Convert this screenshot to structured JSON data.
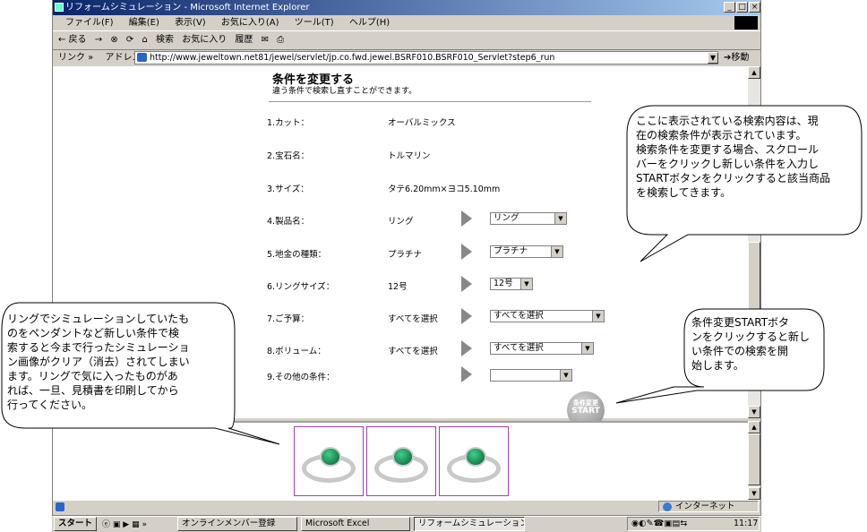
{
  "window": {
    "title": "リフォームシミュレーション - Microsoft Internet Explorer",
    "controls": {
      "minimize": "_",
      "maximize": "□",
      "close": "×"
    }
  },
  "menu": [
    "ファイル(F)",
    "編集(E)",
    "表示(V)",
    "お気に入り(A)",
    "ツール(T)",
    "ヘルプ(H)"
  ],
  "toolbar": {
    "back": "← 戻る",
    "forward": "→",
    "search": "検索",
    "favorites": "お気に入り",
    "history": "履歴"
  },
  "address": {
    "links": "リンク »",
    "label": "アドレス(D)",
    "url": "http://www.jeweltown.net81/jewel/servlet/jp.co.fwd.jewel.BSRF010.BSRF010_Servlet?step6_run",
    "go": "移動"
  },
  "page": {
    "heading": "条件を変更する",
    "subheading": "違う条件で検索し直すことができます。",
    "conditions": [
      {
        "label": "1.カット：",
        "value": "オーバルミックス"
      },
      {
        "label": "2.宝石名：",
        "value": "トルマリン"
      },
      {
        "label": "3.サイズ：",
        "value": "タテ6.20mm×ヨコ5.10mm"
      },
      {
        "label": "4.製品名：",
        "value": "リング",
        "select": "リング"
      },
      {
        "label": "5.地金の種類：",
        "value": "プラチナ",
        "select": "プラチナ"
      },
      {
        "label": "6.リングサイズ：",
        "value": "12号",
        "select": "12号"
      },
      {
        "label": "7.ご予算：",
        "value": "すべてを選択",
        "select": "すべてを選択"
      },
      {
        "label": "8.ボリューム：",
        "value": "すべてを選択",
        "select": "すべてを選択"
      },
      {
        "label": "9.その他の条件：",
        "value": "",
        "select": ""
      }
    ],
    "start_button": {
      "line1": "条件変更",
      "line2": "START"
    }
  },
  "callouts": {
    "top_right": [
      "ここに表示されている検索内容は、現",
      "在の検索条件が表示されています。",
      "検索条件を変更する場合、スクロール",
      "バーをクリックし新しい条件を入力し",
      "STARTボタンをクリックすると該当商品",
      "を検索してきます。"
    ],
    "left": [
      "リングでシミュレーションしていたも",
      "のをペンダントなど新しい条件で検",
      "索すると今まで行ったシミュレーショ",
      "ン画像がクリア（消去）されてしまい",
      "ます。リングで気に入ったものがあ",
      "れば、一旦、見積書を印刷してから",
      "行ってください。"
    ],
    "bottom_right": [
      "条件変更STARTボタ",
      "ンをクリックすると新し",
      "い条件での検索を開",
      "始します。"
    ]
  },
  "status": {
    "zone": "インターネット"
  },
  "taskbar": {
    "start": "スタート",
    "items": [
      "オンラインメンバー登録",
      "Microsoft Excel",
      "リフォームシミュレーション..."
    ],
    "clock": "11:17"
  }
}
